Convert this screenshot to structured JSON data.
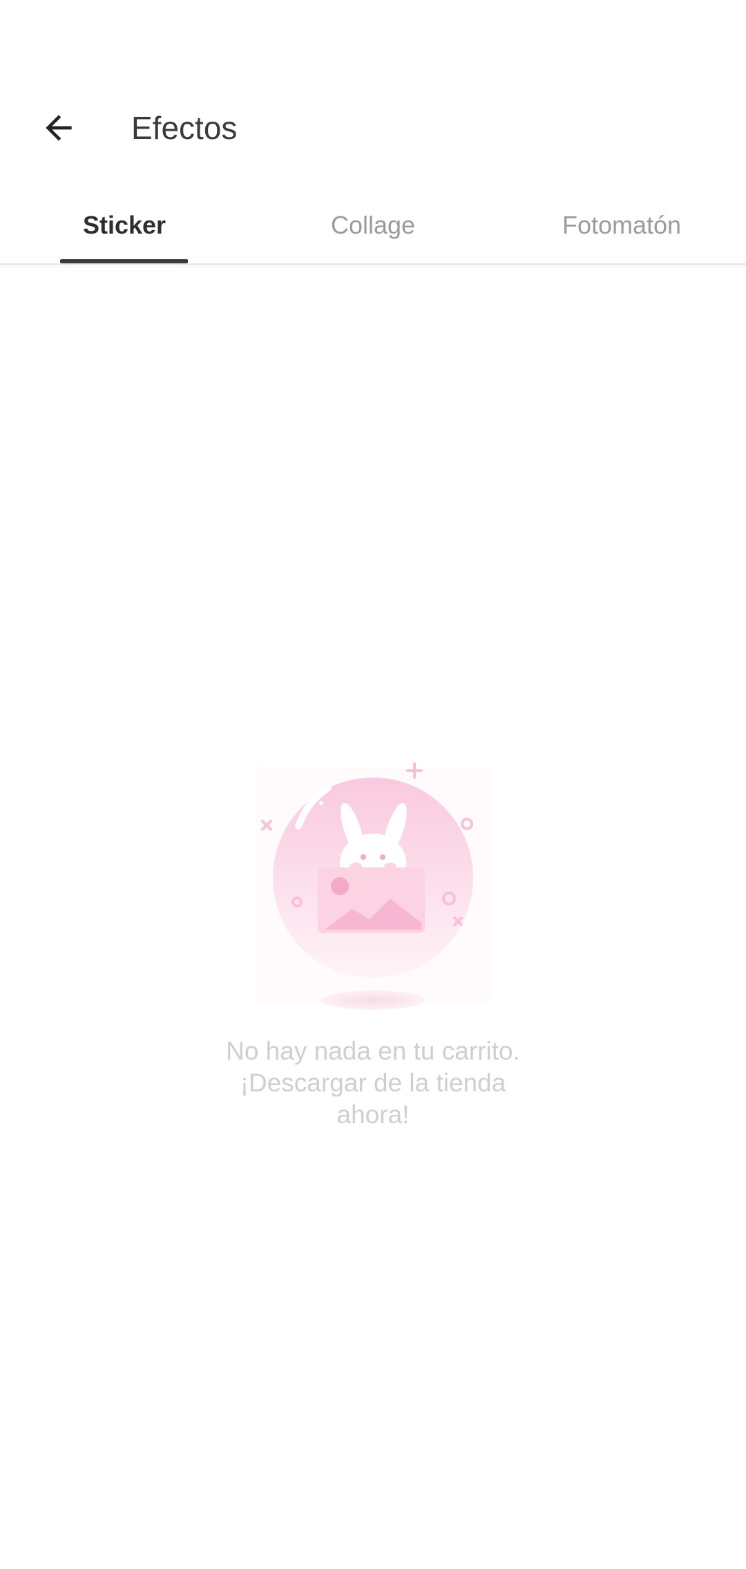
{
  "toolbar": {
    "back_icon": "arrow-left-icon",
    "title": "Efectos"
  },
  "tabs": [
    {
      "label": "Sticker",
      "active": true
    },
    {
      "label": "Collage",
      "active": false
    },
    {
      "label": "Fotomatón",
      "active": false
    }
  ],
  "empty_state": {
    "illustration_icon": "bunny-image-bubble-icon",
    "message": "No hay nada en tu carrito.\n¡Descargar de la tienda\nahora!"
  },
  "colors": {
    "title_text": "#3a3a3a",
    "active_tab_text": "#2e2e2e",
    "inactive_tab_text": "#9b9b9b",
    "indicator": "#3b3b3b",
    "empty_text": "#cfcfcf",
    "illustration_pink": "#f8c6dc"
  }
}
